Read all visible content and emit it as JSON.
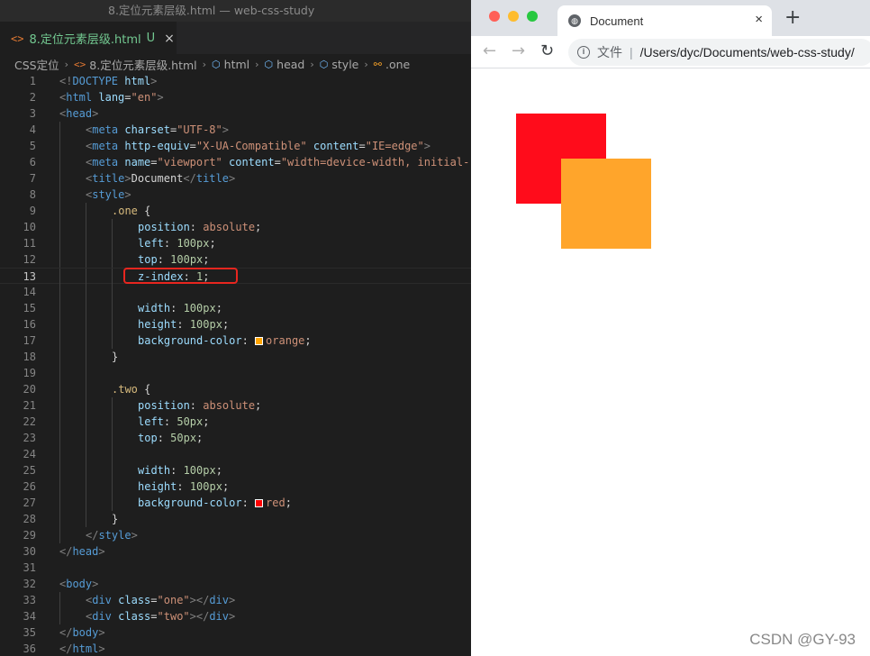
{
  "editor": {
    "window_title": "8.定位元素层级.html — web-css-study",
    "tab": {
      "icon": "<>",
      "name": "8.定位元素层级.html",
      "state": "U",
      "close": "×"
    },
    "breadcrumb": {
      "folder": "CSS定位",
      "file": "8.定位元素层级.html",
      "html": "html",
      "head": "head",
      "style": "style",
      "selector": ".one"
    },
    "active_line": 13,
    "lines": [
      {
        "n": "1",
        "indent": 0,
        "t": [
          [
            "punc",
            "<!"
          ],
          [
            "tag",
            "DOCTYPE"
          ],
          [
            "plain",
            " "
          ],
          [
            "attr",
            "html"
          ],
          [
            "punc",
            ">"
          ]
        ]
      },
      {
        "n": "2",
        "indent": 0,
        "t": [
          [
            "punc",
            "<"
          ],
          [
            "tag",
            "html"
          ],
          [
            "plain",
            " "
          ],
          [
            "attr",
            "lang"
          ],
          [
            "plain",
            "="
          ],
          [
            "str",
            "\"en\""
          ],
          [
            "punc",
            ">"
          ]
        ]
      },
      {
        "n": "3",
        "indent": 0,
        "t": [
          [
            "punc",
            "<"
          ],
          [
            "tag",
            "head"
          ],
          [
            "punc",
            ">"
          ]
        ]
      },
      {
        "n": "4",
        "indent": 1,
        "t": [
          [
            "punc",
            "<"
          ],
          [
            "tag",
            "meta"
          ],
          [
            "plain",
            " "
          ],
          [
            "attr",
            "charset"
          ],
          [
            "plain",
            "="
          ],
          [
            "str",
            "\"UTF-8\""
          ],
          [
            "punc",
            ">"
          ]
        ]
      },
      {
        "n": "5",
        "indent": 1,
        "t": [
          [
            "punc",
            "<"
          ],
          [
            "tag",
            "meta"
          ],
          [
            "plain",
            " "
          ],
          [
            "attr",
            "http-equiv"
          ],
          [
            "plain",
            "="
          ],
          [
            "str",
            "\"X-UA-Compatible\""
          ],
          [
            "plain",
            " "
          ],
          [
            "attr",
            "content"
          ],
          [
            "plain",
            "="
          ],
          [
            "str",
            "\"IE=edge\""
          ],
          [
            "punc",
            ">"
          ]
        ]
      },
      {
        "n": "6",
        "indent": 1,
        "t": [
          [
            "punc",
            "<"
          ],
          [
            "tag",
            "meta"
          ],
          [
            "plain",
            " "
          ],
          [
            "attr",
            "name"
          ],
          [
            "plain",
            "="
          ],
          [
            "str",
            "\"viewport\""
          ],
          [
            "plain",
            " "
          ],
          [
            "attr",
            "content"
          ],
          [
            "plain",
            "="
          ],
          [
            "str",
            "\"width=device-width, initial-"
          ]
        ]
      },
      {
        "n": "7",
        "indent": 1,
        "t": [
          [
            "punc",
            "<"
          ],
          [
            "tag",
            "title"
          ],
          [
            "punc",
            ">"
          ],
          [
            "plain",
            "Document"
          ],
          [
            "punc",
            "</"
          ],
          [
            "tag",
            "title"
          ],
          [
            "punc",
            ">"
          ]
        ]
      },
      {
        "n": "8",
        "indent": 1,
        "t": [
          [
            "punc",
            "<"
          ],
          [
            "tag",
            "style"
          ],
          [
            "punc",
            ">"
          ]
        ]
      },
      {
        "n": "9",
        "indent": 2,
        "t": [
          [
            "sel",
            ".one"
          ],
          [
            "plain",
            " {"
          ]
        ]
      },
      {
        "n": "10",
        "indent": 3,
        "t": [
          [
            "prop",
            "position"
          ],
          [
            "plain",
            ": "
          ],
          [
            "val",
            "absolute"
          ],
          [
            "plain",
            ";"
          ]
        ]
      },
      {
        "n": "11",
        "indent": 3,
        "t": [
          [
            "prop",
            "left"
          ],
          [
            "plain",
            ": "
          ],
          [
            "num",
            "100px"
          ],
          [
            "plain",
            ";"
          ]
        ]
      },
      {
        "n": "12",
        "indent": 3,
        "t": [
          [
            "prop",
            "top"
          ],
          [
            "plain",
            ": "
          ],
          [
            "num",
            "100px"
          ],
          [
            "plain",
            ";"
          ]
        ]
      },
      {
        "n": "13",
        "indent": 3,
        "t": [
          [
            "prop",
            "z-index"
          ],
          [
            "plain",
            ": "
          ],
          [
            "num",
            "1"
          ],
          [
            "plain",
            ";"
          ]
        ]
      },
      {
        "n": "14",
        "indent": 3,
        "t": []
      },
      {
        "n": "15",
        "indent": 3,
        "t": [
          [
            "prop",
            "width"
          ],
          [
            "plain",
            ": "
          ],
          [
            "num",
            "100px"
          ],
          [
            "plain",
            ";"
          ]
        ]
      },
      {
        "n": "16",
        "indent": 3,
        "t": [
          [
            "prop",
            "height"
          ],
          [
            "plain",
            ": "
          ],
          [
            "num",
            "100px"
          ],
          [
            "plain",
            ";"
          ]
        ]
      },
      {
        "n": "17",
        "indent": 3,
        "t": [
          [
            "prop",
            "background-color"
          ],
          [
            "plain",
            ": "
          ],
          [
            "swatch",
            "#ffa500"
          ],
          [
            "val",
            "orange"
          ],
          [
            "plain",
            ";"
          ]
        ]
      },
      {
        "n": "18",
        "indent": 2,
        "t": [
          [
            "plain",
            "}"
          ]
        ]
      },
      {
        "n": "19",
        "indent": 2,
        "t": []
      },
      {
        "n": "20",
        "indent": 2,
        "t": [
          [
            "sel",
            ".two"
          ],
          [
            "plain",
            " {"
          ]
        ]
      },
      {
        "n": "21",
        "indent": 3,
        "t": [
          [
            "prop",
            "position"
          ],
          [
            "plain",
            ": "
          ],
          [
            "val",
            "absolute"
          ],
          [
            "plain",
            ";"
          ]
        ]
      },
      {
        "n": "22",
        "indent": 3,
        "t": [
          [
            "prop",
            "left"
          ],
          [
            "plain",
            ": "
          ],
          [
            "num",
            "50px"
          ],
          [
            "plain",
            ";"
          ]
        ]
      },
      {
        "n": "23",
        "indent": 3,
        "t": [
          [
            "prop",
            "top"
          ],
          [
            "plain",
            ": "
          ],
          [
            "num",
            "50px"
          ],
          [
            "plain",
            ";"
          ]
        ]
      },
      {
        "n": "24",
        "indent": 3,
        "t": []
      },
      {
        "n": "25",
        "indent": 3,
        "t": [
          [
            "prop",
            "width"
          ],
          [
            "plain",
            ": "
          ],
          [
            "num",
            "100px"
          ],
          [
            "plain",
            ";"
          ]
        ]
      },
      {
        "n": "26",
        "indent": 3,
        "t": [
          [
            "prop",
            "height"
          ],
          [
            "plain",
            ": "
          ],
          [
            "num",
            "100px"
          ],
          [
            "plain",
            ";"
          ]
        ]
      },
      {
        "n": "27",
        "indent": 3,
        "t": [
          [
            "prop",
            "background-color"
          ],
          [
            "plain",
            ": "
          ],
          [
            "swatch",
            "#ff0000"
          ],
          [
            "val",
            "red"
          ],
          [
            "plain",
            ";"
          ]
        ]
      },
      {
        "n": "28",
        "indent": 2,
        "t": [
          [
            "plain",
            "}"
          ]
        ]
      },
      {
        "n": "29",
        "indent": 1,
        "t": [
          [
            "punc",
            "</"
          ],
          [
            "tag",
            "style"
          ],
          [
            "punc",
            ">"
          ]
        ]
      },
      {
        "n": "30",
        "indent": 0,
        "t": [
          [
            "punc",
            "</"
          ],
          [
            "tag",
            "head"
          ],
          [
            "punc",
            ">"
          ]
        ]
      },
      {
        "n": "31",
        "indent": 0,
        "t": []
      },
      {
        "n": "32",
        "indent": 0,
        "t": [
          [
            "punc",
            "<"
          ],
          [
            "tag",
            "body"
          ],
          [
            "punc",
            ">"
          ]
        ]
      },
      {
        "n": "33",
        "indent": 1,
        "t": [
          [
            "punc",
            "<"
          ],
          [
            "tag",
            "div"
          ],
          [
            "plain",
            " "
          ],
          [
            "attr",
            "class"
          ],
          [
            "plain",
            "="
          ],
          [
            "str",
            "\"one\""
          ],
          [
            "punc",
            "></"
          ],
          [
            "tag",
            "div"
          ],
          [
            "punc",
            ">"
          ]
        ]
      },
      {
        "n": "34",
        "indent": 1,
        "t": [
          [
            "punc",
            "<"
          ],
          [
            "tag",
            "div"
          ],
          [
            "plain",
            " "
          ],
          [
            "attr",
            "class"
          ],
          [
            "plain",
            "="
          ],
          [
            "str",
            "\"two\""
          ],
          [
            "punc",
            "></"
          ],
          [
            "tag",
            "div"
          ],
          [
            "punc",
            ">"
          ]
        ]
      },
      {
        "n": "35",
        "indent": 0,
        "t": [
          [
            "punc",
            "</"
          ],
          [
            "tag",
            "body"
          ],
          [
            "punc",
            ">"
          ]
        ]
      },
      {
        "n": "36",
        "indent": 0,
        "t": [
          [
            "punc",
            "</"
          ],
          [
            "tag",
            "html"
          ],
          [
            "punc",
            ">"
          ]
        ]
      }
    ]
  },
  "browser": {
    "tab_title": "Document",
    "tab_close": "×",
    "new_tab": "+",
    "back": "←",
    "forward": "→",
    "reload": "↻",
    "scheme_label": "文件",
    "url": "/Users/dyc/Documents/web-css-study/",
    "traffic_lights": [
      "#ff5f57",
      "#febc2e",
      "#28c840"
    ],
    "rendered": {
      "one": {
        "color": "#ffa52b",
        "z_index": 1
      },
      "two": {
        "color": "#ff0c1b",
        "z_index": 0
      }
    }
  },
  "watermark": "CSDN @GY-93",
  "colors": {
    "editor_bg": "#1e1e1e",
    "highlight_box": "#e8261f",
    "tab_untracked": "#73c991"
  }
}
